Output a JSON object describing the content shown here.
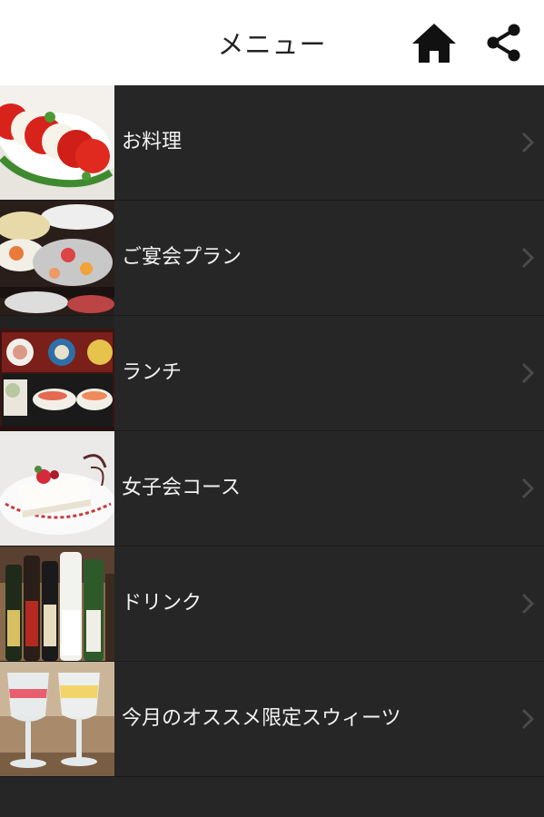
{
  "header": {
    "title": "メニュー",
    "home_icon": "home-icon",
    "share_icon": "share-icon"
  },
  "colors": {
    "header_bg": "#ffffff",
    "list_bg": "#262626",
    "text": "#f2f2f2",
    "chevron": "#4a4a4a"
  },
  "menu": {
    "items": [
      {
        "label": "お料理",
        "thumbnail": "caprese-salad-photo"
      },
      {
        "label": "ご宴会プラン",
        "thumbnail": "banquet-dishes-photo"
      },
      {
        "label": "ランチ",
        "thumbnail": "lunch-set-photo"
      },
      {
        "label": "女子会コース",
        "thumbnail": "dessert-plate-photo"
      },
      {
        "label": "ドリンク",
        "thumbnail": "sake-bottles-photo"
      },
      {
        "label": "今月のオススメ限定スウィーツ",
        "thumbnail": "pudding-glasses-photo"
      }
    ]
  }
}
